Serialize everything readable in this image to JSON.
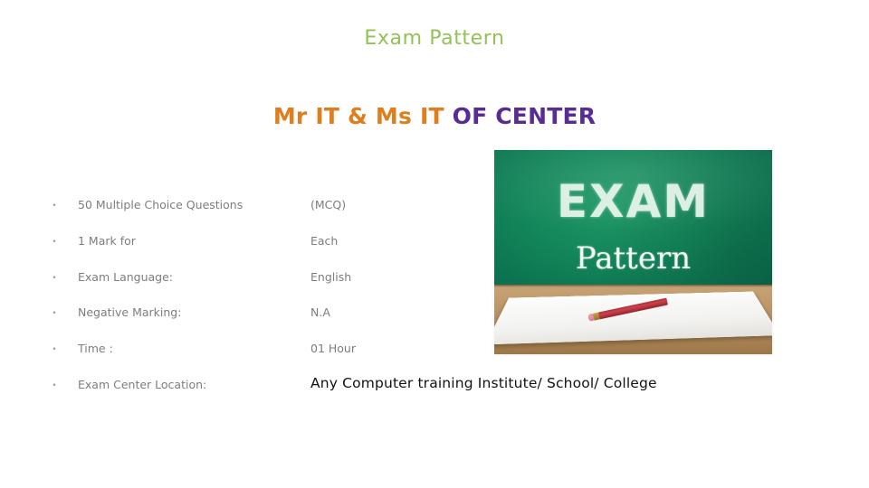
{
  "slide": {
    "title": "Exam Pattern",
    "subtitle": {
      "part_orange": "Mr IT & Ms IT",
      "part_purple": " OF CENTER"
    },
    "colors": {
      "title_green": "#94c257",
      "subtitle_orange": "#e07d1c",
      "subtitle_purple": "#5a2b94",
      "body_gray": "#7d7d7d",
      "emphasis_black": "#121212",
      "background": "#ffffff",
      "board_green": "#13855a",
      "desk_wood": "#c19b6c"
    },
    "bullets": [
      {
        "marker": "•",
        "label": "50 Multiple Choice Questions",
        "value": "(MCQ)"
      },
      {
        "marker": "•",
        "label": "1 Mark for",
        "value": "Each"
      },
      {
        "marker": "•",
        "label": "Exam Language:",
        "value": "English"
      },
      {
        "marker": "•",
        "label": "Negative Marking:",
        "value": "N.A"
      },
      {
        "marker": "•",
        "label": "Time :",
        "value": "01 Hour"
      },
      {
        "marker": "•",
        "label": "Exam Center Location:",
        "value": "Any Computer training Institute/ School/ College"
      }
    ],
    "picture": {
      "alt": "exam-pattern-chalkboard-photo",
      "chalk_line1": "EXAM",
      "chalk_line2": "Pattern"
    }
  }
}
